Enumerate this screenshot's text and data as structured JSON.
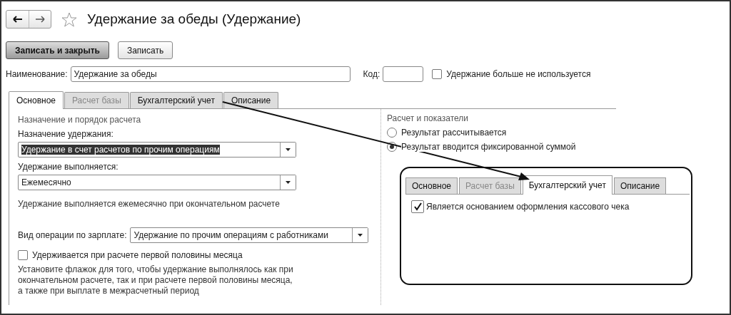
{
  "window": {
    "title": "Удержание за обеды (Удержание)",
    "favorite": false
  },
  "toolbar": {
    "buttons": [
      {
        "label": "Записать и закрыть",
        "default": true
      },
      {
        "label": "Записать",
        "default": false
      }
    ]
  },
  "name_field": {
    "label": "Наименование:",
    "value": "Удержание за обеды"
  },
  "code_field": {
    "label": "Код:"
  },
  "not_used": {
    "label": "Удержание больше не используется",
    "checked": false
  },
  "tabs": [
    {
      "label": "Основное",
      "selected": true,
      "disabled": false
    },
    {
      "label": "Расчет базы",
      "selected": false,
      "disabled": true
    },
    {
      "label": "Бухгалтерский учет",
      "selected": false,
      "disabled": false
    },
    {
      "label": "Описание",
      "selected": false,
      "disabled": false
    }
  ],
  "left_group": {
    "title": "Назначение и порядок расчета",
    "purpose": {
      "label": "Назначение удержания:",
      "value": "Удержание в счет расчетов по прочим операциям",
      "highlighted": true
    },
    "schedule": {
      "label": "Удержание выполняется:",
      "value": "Ежемесячно",
      "highlighted": false
    },
    "schedule_hint": "Удержание выполняется ежемесячно при окончательном расчете",
    "operation": {
      "label": "Вид операции по зарплате:",
      "value": "Удержание по прочим операциям с работниками",
      "highlighted": false
    },
    "first_half": {
      "label": "Удерживается при расчете первой половины месяца",
      "checked": false
    },
    "first_half_hint": "Установите флажок для того, чтобы удержание выполнялось как при окончательном расчете, так и при расчете первой половины месяца, а также при выплате в межрасчетный период"
  },
  "right_group": {
    "title": "Расчет и показатели",
    "options": [
      {
        "label": "Результат рассчитывается",
        "selected": false
      },
      {
        "label": "Результат вводится фиксированной суммой",
        "selected": true
      }
    ]
  },
  "callout": {
    "tabs": [
      {
        "label": "Основное",
        "selected": false,
        "disabled": false
      },
      {
        "label": "Расчет базы",
        "selected": false,
        "disabled": true
      },
      {
        "label": "Бухгалтерский учет",
        "selected": true,
        "disabled": false
      },
      {
        "label": "Описание",
        "selected": false,
        "disabled": false
      }
    ],
    "checkbox": {
      "label": "Является основанием оформления кассового чека",
      "checked": true
    }
  }
}
